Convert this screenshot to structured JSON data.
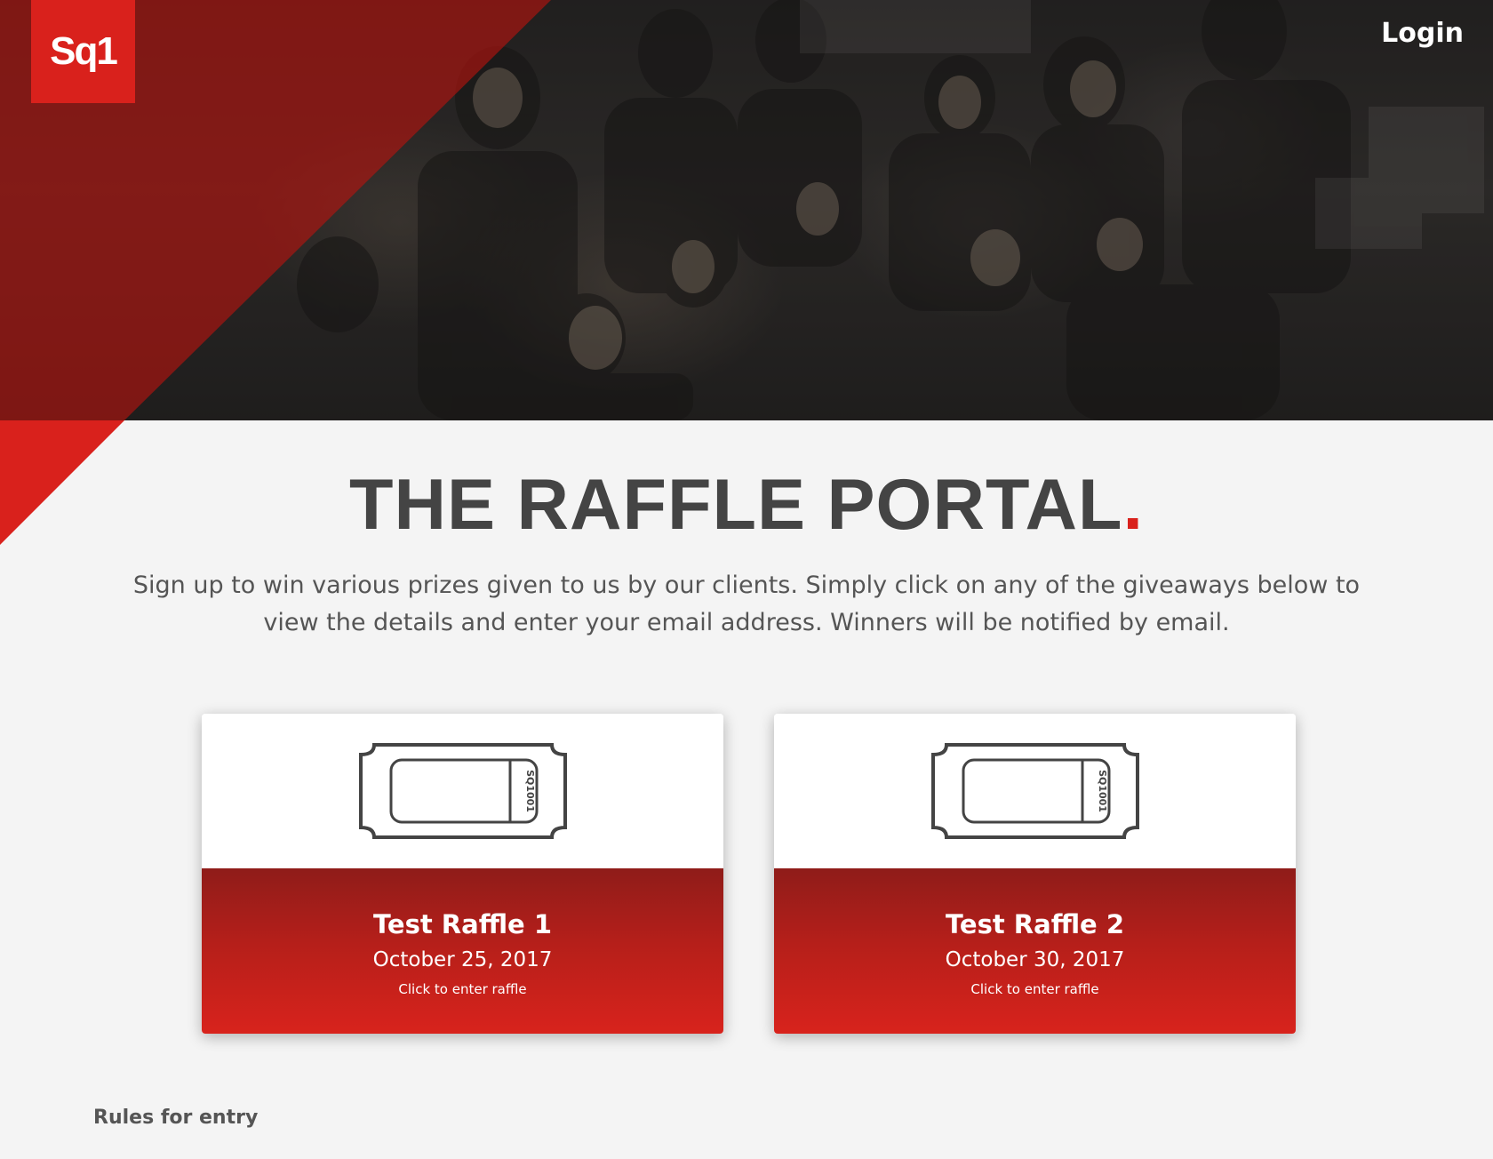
{
  "header": {
    "logo_text": "Sq1",
    "login_label": "Login"
  },
  "hero": {
    "image": "crowd-cheering-photo"
  },
  "main": {
    "title": "THE RAFFLE PORTAL",
    "title_dot": ".",
    "intro": "Sign up to win various prizes given to us by our clients. Simply click on any of the giveaways below to view the details and enter your email address. Winners will be notified by email."
  },
  "raffles": [
    {
      "ticket_serial": "SQ1001",
      "title": "Test Raffle 1",
      "date": "October 25, 2017",
      "cta": "Click to enter raffle",
      "icon": "ticket-icon"
    },
    {
      "ticket_serial": "SQ1001",
      "title": "Test Raffle 2",
      "date": "October 30, 2017",
      "cta": "Click to enter raffle",
      "icon": "ticket-icon"
    }
  ],
  "footer": {
    "rules_label": "Rules for entry"
  },
  "colors": {
    "brand_red": "#d9211c",
    "card_gradient_top": "#8f1c19",
    "card_gradient_bottom": "#d8231c",
    "title_gray": "#444444",
    "background": "#f4f4f4"
  }
}
